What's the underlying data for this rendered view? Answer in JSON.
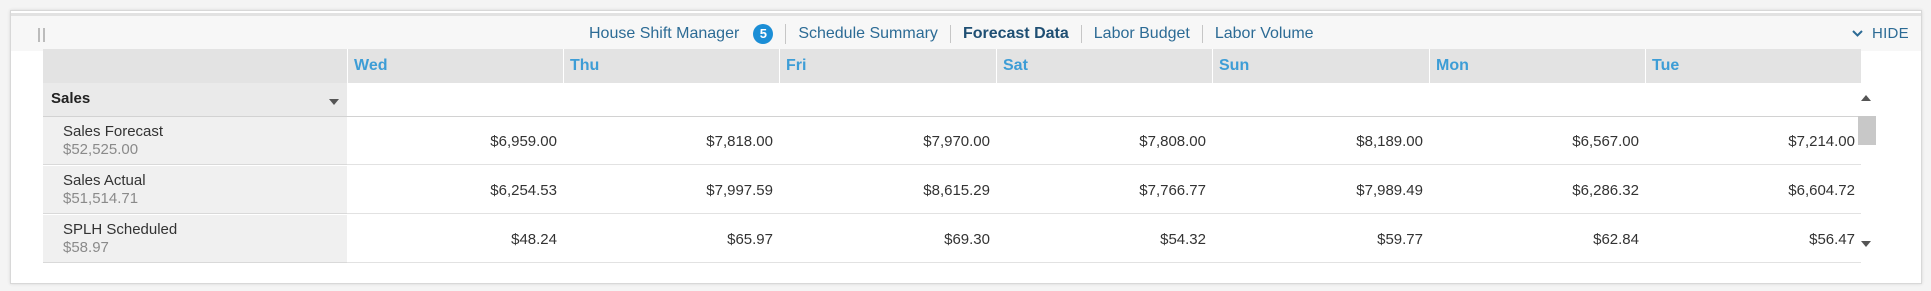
{
  "nav": {
    "items": [
      {
        "label": "House Shift Manager",
        "badge": "5"
      },
      {
        "label": "Schedule Summary"
      },
      {
        "label": "Forecast Data",
        "active": true
      },
      {
        "label": "Labor Budget"
      },
      {
        "label": "Labor Volume"
      }
    ],
    "hide_label": "HIDE"
  },
  "grid": {
    "section_label": "Sales",
    "days": [
      "Wed",
      "Thu",
      "Fri",
      "Sat",
      "Sun",
      "Mon",
      "Tue"
    ],
    "rows": [
      {
        "name": "Sales Forecast",
        "total": "$52,525.00",
        "values": [
          "$6,959.00",
          "$7,818.00",
          "$7,970.00",
          "$7,808.00",
          "$8,189.00",
          "$6,567.00",
          "$7,214.00"
        ]
      },
      {
        "name": "Sales Actual",
        "total": "$51,514.71",
        "values": [
          "$6,254.53",
          "$7,997.59",
          "$8,615.29",
          "$7,766.77",
          "$7,989.49",
          "$6,286.32",
          "$6,604.72"
        ]
      },
      {
        "name": "SPLH Scheduled",
        "total": "$58.97",
        "values": [
          "$48.24",
          "$65.97",
          "$69.30",
          "$54.32",
          "$59.77",
          "$62.84",
          "$56.47"
        ]
      }
    ]
  },
  "colors": {
    "accent": "#1b8ed6",
    "day_header_text": "#3d9dd6",
    "nav_text": "#2c6b95"
  }
}
